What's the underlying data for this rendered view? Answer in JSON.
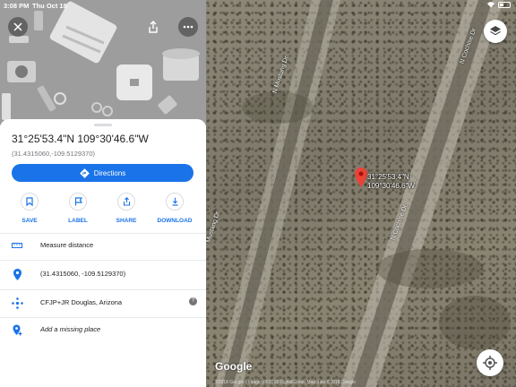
{
  "status_bar": {
    "time": "3:08 PM",
    "date": "Thu Oct 18"
  },
  "place": {
    "dms_coordinates": "31°25'53.4\"N 109°30'46.6\"W",
    "decimal_coordinates": "(31.4315060,-109.5129370)"
  },
  "directions_label": "Directions",
  "actions": [
    {
      "label": "SAVE",
      "icon": "bookmark-icon"
    },
    {
      "label": "LABEL",
      "icon": "flag-icon"
    },
    {
      "label": "SHARE",
      "icon": "share-icon"
    },
    {
      "label": "DOWNLOAD",
      "icon": "download-icon"
    }
  ],
  "rows": [
    {
      "label": "Measure distance",
      "icon": "ruler-icon"
    },
    {
      "label": "(31.4315060, -109.5129370)",
      "icon": "location-pin-icon"
    },
    {
      "label": "CFJP+JR Douglas, Arizona",
      "icon": "plus-code-icon",
      "help": "?"
    },
    {
      "label": "Add a missing place",
      "icon": "add-place-icon"
    }
  ],
  "map": {
    "pin_label_line1": "31°25'53.4\"N",
    "pin_label_line2": "109°30'46.6\"W",
    "road_left": "N Mustang Dr",
    "road_left_lower": "Mustang Dr",
    "road_right": "N Cochise Dr",
    "road_right_lower": "N Cochise Dr",
    "logo": "Google",
    "attribution": "©2018 Google · Imagery ©2018 DigitalGlobe, Map data ©2018 Google"
  },
  "colors": {
    "accent": "#1a73e8",
    "pin": "#ea4335"
  }
}
